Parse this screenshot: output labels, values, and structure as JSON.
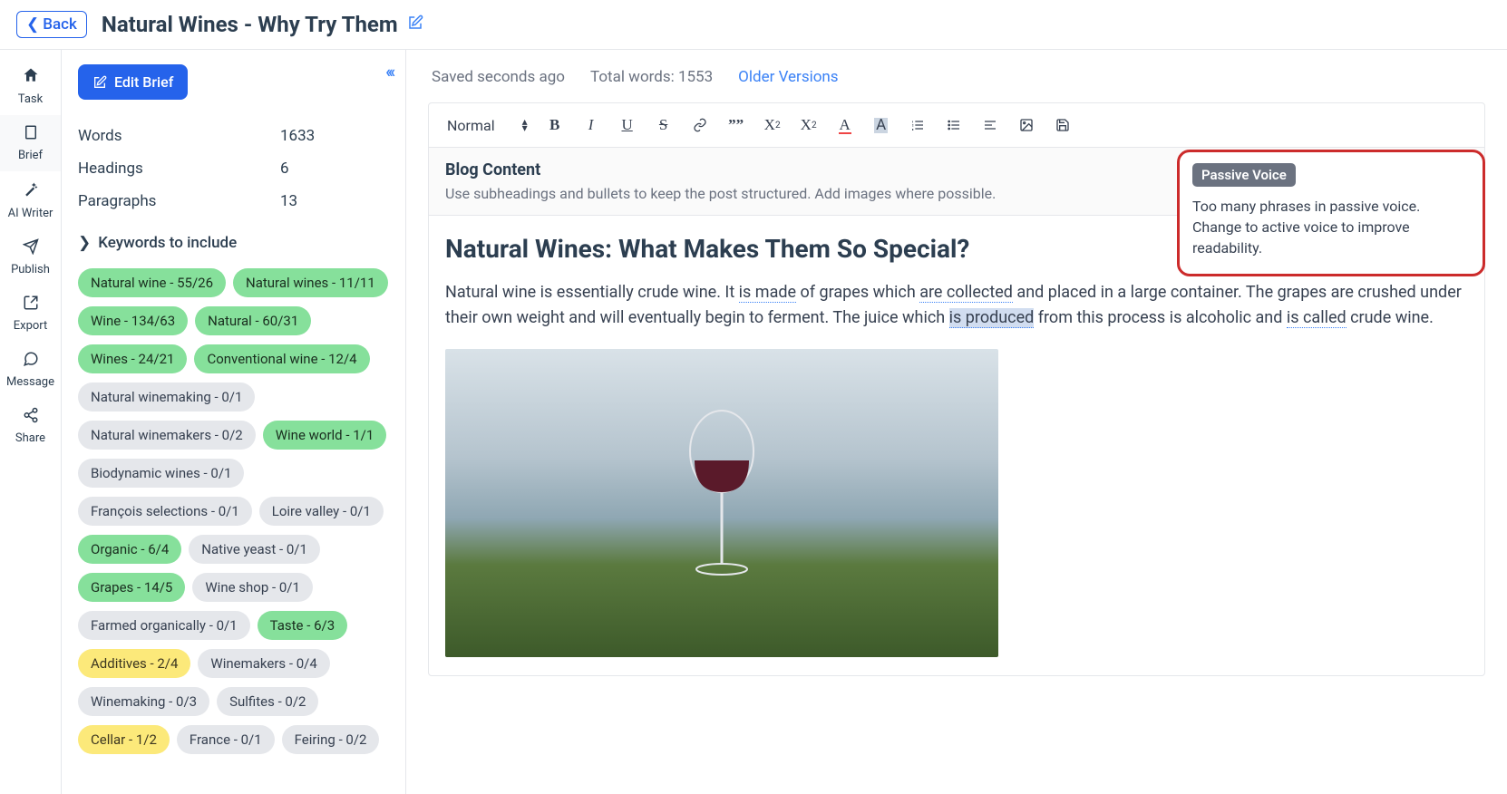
{
  "topbar": {
    "back_label": "Back",
    "title": "Natural Wines - Why Try Them"
  },
  "nav": {
    "items": [
      {
        "label": "Task",
        "icon": "home"
      },
      {
        "label": "Brief",
        "icon": "doc"
      },
      {
        "label": "AI Writer",
        "icon": "wand"
      },
      {
        "label": "Publish",
        "icon": "send"
      },
      {
        "label": "Export",
        "icon": "export"
      },
      {
        "label": "Message",
        "icon": "chat"
      },
      {
        "label": "Share",
        "icon": "share"
      }
    ]
  },
  "sidebar": {
    "edit_brief_label": "Edit Brief",
    "stats": [
      {
        "label": "Words",
        "value": "1633"
      },
      {
        "label": "Headings",
        "value": "6"
      },
      {
        "label": "Paragraphs",
        "value": "13"
      }
    ],
    "kw_header": "Keywords to include",
    "keywords": [
      {
        "text": "Natural wine - 55/26",
        "cls": "kw-green"
      },
      {
        "text": "Natural wines - 11/11",
        "cls": "kw-green"
      },
      {
        "text": "Wine - 134/63",
        "cls": "kw-green"
      },
      {
        "text": "Natural - 60/31",
        "cls": "kw-green"
      },
      {
        "text": "Wines - 24/21",
        "cls": "kw-green"
      },
      {
        "text": "Conventional wine - 12/4",
        "cls": "kw-green"
      },
      {
        "text": "Natural winemaking - 0/1",
        "cls": "kw-gray"
      },
      {
        "text": "Natural winemakers - 0/2",
        "cls": "kw-gray"
      },
      {
        "text": "Wine world - 1/1",
        "cls": "kw-green"
      },
      {
        "text": "Biodynamic wines - 0/1",
        "cls": "kw-gray"
      },
      {
        "text": "François selections - 0/1",
        "cls": "kw-gray"
      },
      {
        "text": "Loire valley - 0/1",
        "cls": "kw-gray"
      },
      {
        "text": "Organic - 6/4",
        "cls": "kw-green"
      },
      {
        "text": "Native yeast - 0/1",
        "cls": "kw-gray"
      },
      {
        "text": "Grapes - 14/5",
        "cls": "kw-green"
      },
      {
        "text": "Wine shop - 0/1",
        "cls": "kw-gray"
      },
      {
        "text": "Farmed organically - 0/1",
        "cls": "kw-gray"
      },
      {
        "text": "Taste - 6/3",
        "cls": "kw-green"
      },
      {
        "text": "Additives - 2/4",
        "cls": "kw-yellow"
      },
      {
        "text": "Winemakers - 0/4",
        "cls": "kw-gray"
      },
      {
        "text": "Winemaking - 0/3",
        "cls": "kw-gray"
      },
      {
        "text": "Sulfites - 0/2",
        "cls": "kw-gray"
      },
      {
        "text": "Cellar - 1/2",
        "cls": "kw-yellow"
      },
      {
        "text": "France - 0/1",
        "cls": "kw-gray"
      },
      {
        "text": "Feiring - 0/2",
        "cls": "kw-gray"
      }
    ]
  },
  "meta": {
    "saved": "Saved seconds ago",
    "total_words": "Total words: 1553",
    "older_versions": "Older Versions"
  },
  "toolbar": {
    "format_select": "Normal"
  },
  "section": {
    "title": "Blog Content",
    "hint": "Use subheadings and bullets to keep the post structured. Add images where possible."
  },
  "content": {
    "heading": "Natural Wines: What Makes Them So Special?",
    "p1_a": "Natural wine is essentially crude wine. It ",
    "p1_pv1": "is made",
    "p1_b": " of grapes which ",
    "p1_pv2": "are collected",
    "p1_c": " and placed in a large container. The grapes are crushed under their own weight and will eventually begin to ferment. The juice which ",
    "p1_pv3": "is produced",
    "p1_d": " from this process is alcoholic and ",
    "p1_pv4": "is called",
    "p1_e": " crude wine."
  },
  "tip": {
    "badge": "Passive Voice",
    "text": "Too many phrases in passive voice. Change to active voice to improve readability."
  }
}
